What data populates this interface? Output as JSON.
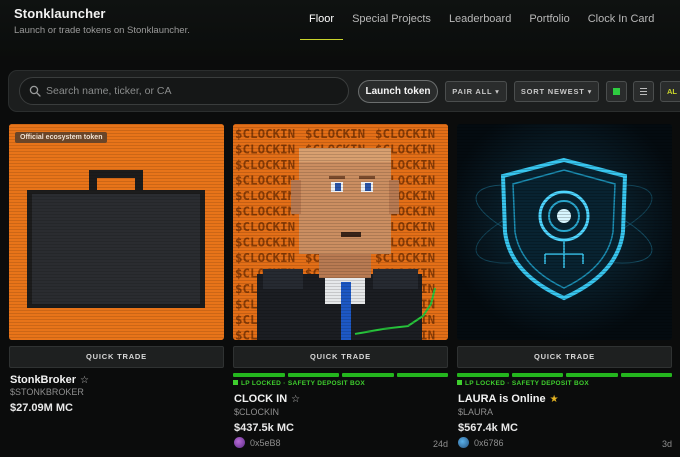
{
  "app": {
    "title": "Stonklauncher",
    "subtitle": "Launch or trade tokens on Stonklauncher."
  },
  "nav": [
    "Floor",
    "Special Projects",
    "Leaderboard",
    "Portfolio",
    "Clock In Card"
  ],
  "search": {
    "placeholder": "Search name, ticker, or CA"
  },
  "toolbar": {
    "launch_label": "Launch token",
    "pair_label": "PAIR ALL",
    "sort_label": "SORT NEWEST",
    "all_label": "AL"
  },
  "tokens": [
    {
      "badge": "Official ecosystem token",
      "name": "StonkBroker",
      "ticker": "$STONKBROKER",
      "mc": "$27.09M MC",
      "quick_trade": "QUICK TRADE",
      "star": "☆"
    },
    {
      "name": "CLOCK IN",
      "ticker": "$CLOCKIN",
      "mc": "$437.5k MC",
      "lp": "LP LOCKED · SAFETY DEPOSIT BOX",
      "creator": "0x5eB8",
      "age": "24d",
      "quick_trade": "QUICK TRADE",
      "star": "☆",
      "art_text": "$CLOCKIN"
    },
    {
      "name": "LAURA is Online",
      "ticker": "$LAURA",
      "mc": "$567.4k MC",
      "lp": "LP LOCKED · SAFETY DEPOSIT BOX",
      "creator": "0x6786",
      "age": "3d",
      "quick_trade": "QUICK TRADE",
      "star": "★"
    }
  ],
  "colors": {
    "accent": "#c9d42b",
    "lp_green": "#24b61e",
    "card_orange": "#e8731a"
  }
}
